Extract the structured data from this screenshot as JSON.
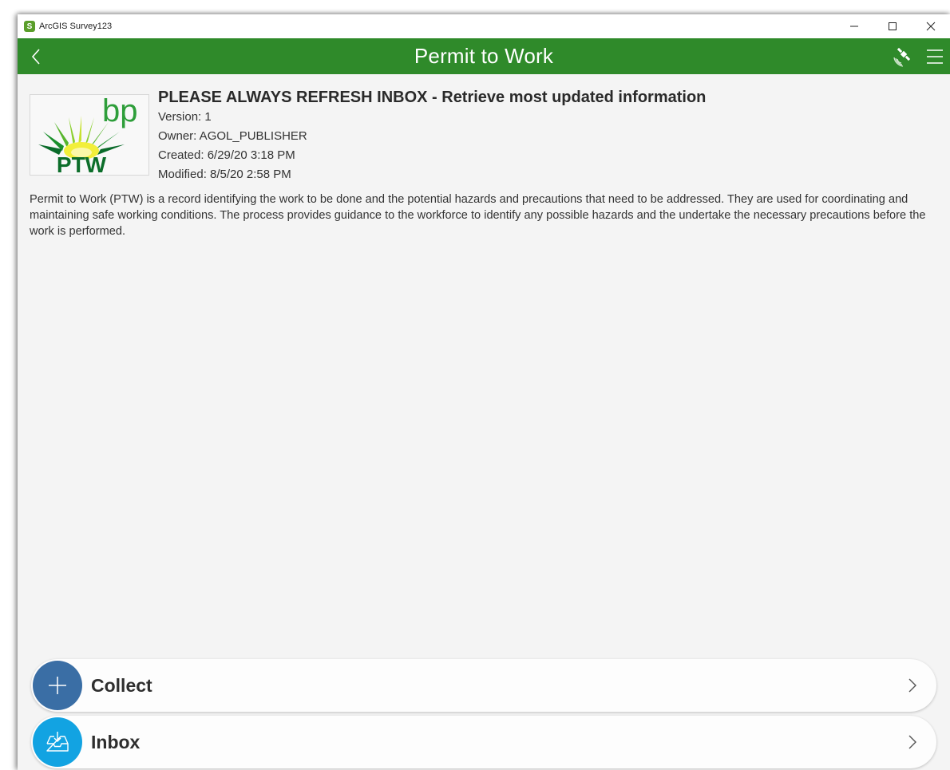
{
  "window": {
    "app_title": "ArcGIS Survey123"
  },
  "appbar": {
    "title": "Permit to Work"
  },
  "survey": {
    "title": "PLEASE ALWAYS REFRESH INBOX - Retrieve most updated information",
    "version": "Version: 1",
    "owner": "Owner: AGOL_PUBLISHER",
    "created": "Created: 6/29/20 3:18 PM",
    "modified": "Modified: 8/5/20 2:58 PM",
    "description": "Permit to Work (PTW) is a record identifying the work to be done and the potential hazards and precautions that need to be addressed. They are used for coordinating and maintaining safe working conditions. The process provides guidance to the workforce to identify any possible hazards and the undertake the necessary precautions before the work is performed."
  },
  "logo": {
    "brand": "bp",
    "text": "PTW"
  },
  "actions": [
    {
      "label": "Collect",
      "icon": "plus-icon",
      "color": "#3a6ea5"
    },
    {
      "label": "Inbox",
      "icon": "inbox-download-icon",
      "color": "#12a3e2"
    }
  ],
  "colors": {
    "appbar": "#2f8a2a",
    "background": "#f4f4f4"
  }
}
